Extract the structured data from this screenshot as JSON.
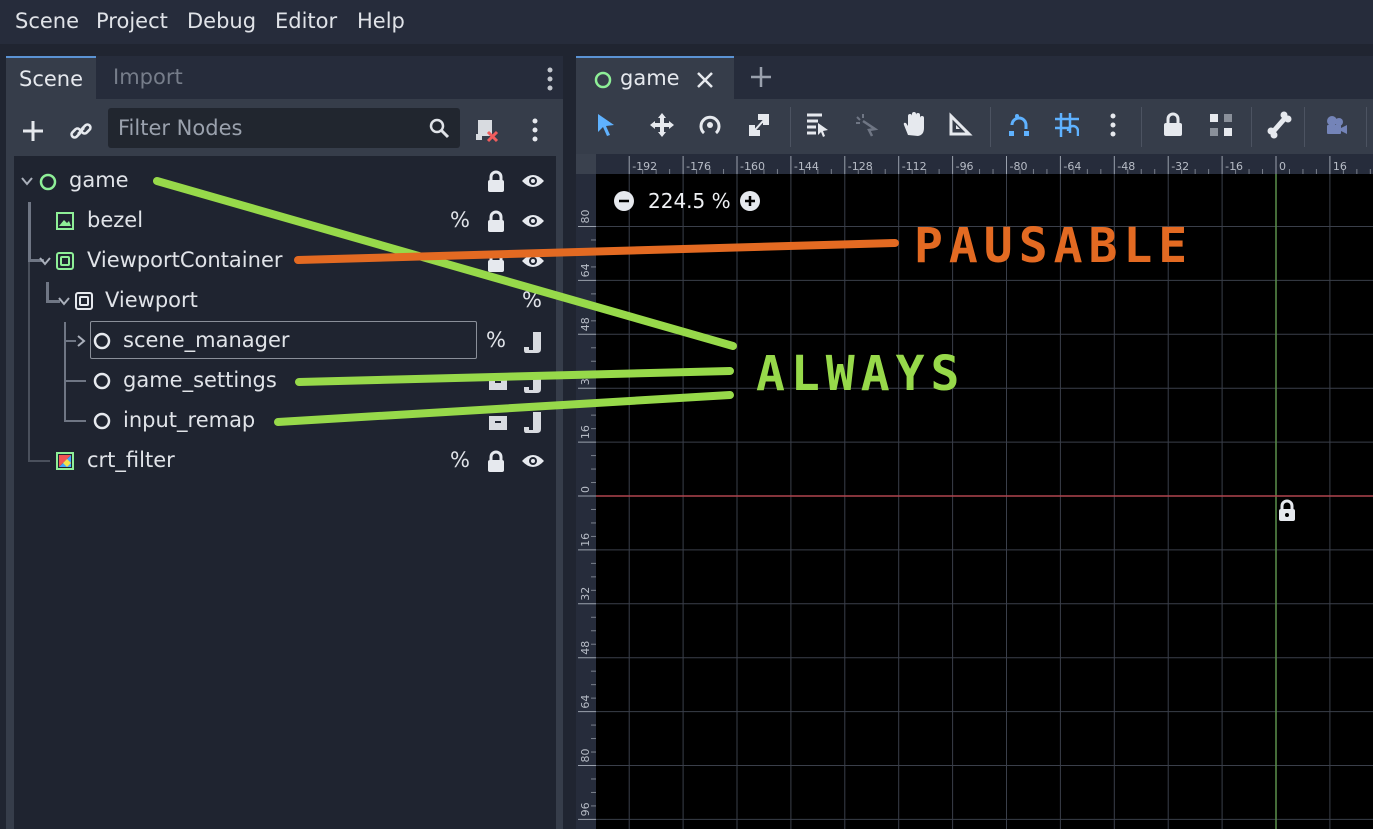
{
  "menubar": {
    "items": [
      "Scene",
      "Project",
      "Debug",
      "Editor",
      "Help"
    ]
  },
  "dock": {
    "tabs": [
      "Scene",
      "Import"
    ],
    "filter": {
      "placeholder": "Filter Nodes",
      "value": ""
    }
  },
  "tree": {
    "nodes": [
      {
        "label": "game",
        "icon": "node-circle-icon",
        "expanded": true
      },
      {
        "label": "bezel",
        "icon": "texture-rect-icon",
        "toggles": [
          "%",
          "lock",
          "eye"
        ]
      },
      {
        "label": "ViewportContainer",
        "icon": "viewport-container-icon",
        "expanded": true
      },
      {
        "label": "Viewport",
        "icon": "viewport-icon",
        "expanded": true,
        "toggles": [
          "%"
        ]
      },
      {
        "label": "scene_manager",
        "icon": "node-circle-icon",
        "collapsed": true,
        "toggles": [
          "%",
          "script"
        ]
      },
      {
        "label": "game_settings",
        "icon": "node-circle-icon"
      },
      {
        "label": "input_remap",
        "icon": "node-circle-icon"
      },
      {
        "label": "crt_filter",
        "icon": "color-rect-icon",
        "toggles": [
          "%",
          "lock",
          "eye"
        ]
      }
    ]
  },
  "editor": {
    "tab_label": "game",
    "zoom": "224.5 %",
    "ruler_top": [
      "-192",
      "-176",
      "-160",
      "-144",
      "-128",
      "-112",
      "-96",
      "-80",
      "-64",
      "-48",
      "-32",
      "-16",
      "0",
      "16"
    ],
    "ruler_left": [
      "80",
      "64",
      "48",
      "32",
      "16",
      "0",
      "16",
      "32",
      "48",
      "64",
      "80",
      "96"
    ]
  },
  "annotations": {
    "pausable": "PAUSABLE",
    "always": "ALWAYS",
    "pausable_color": "#e36a22",
    "always_color": "#97d94a"
  },
  "colors": {
    "accent": "#5b93d4",
    "node_icon": "#8eef97",
    "background": "#202531"
  }
}
